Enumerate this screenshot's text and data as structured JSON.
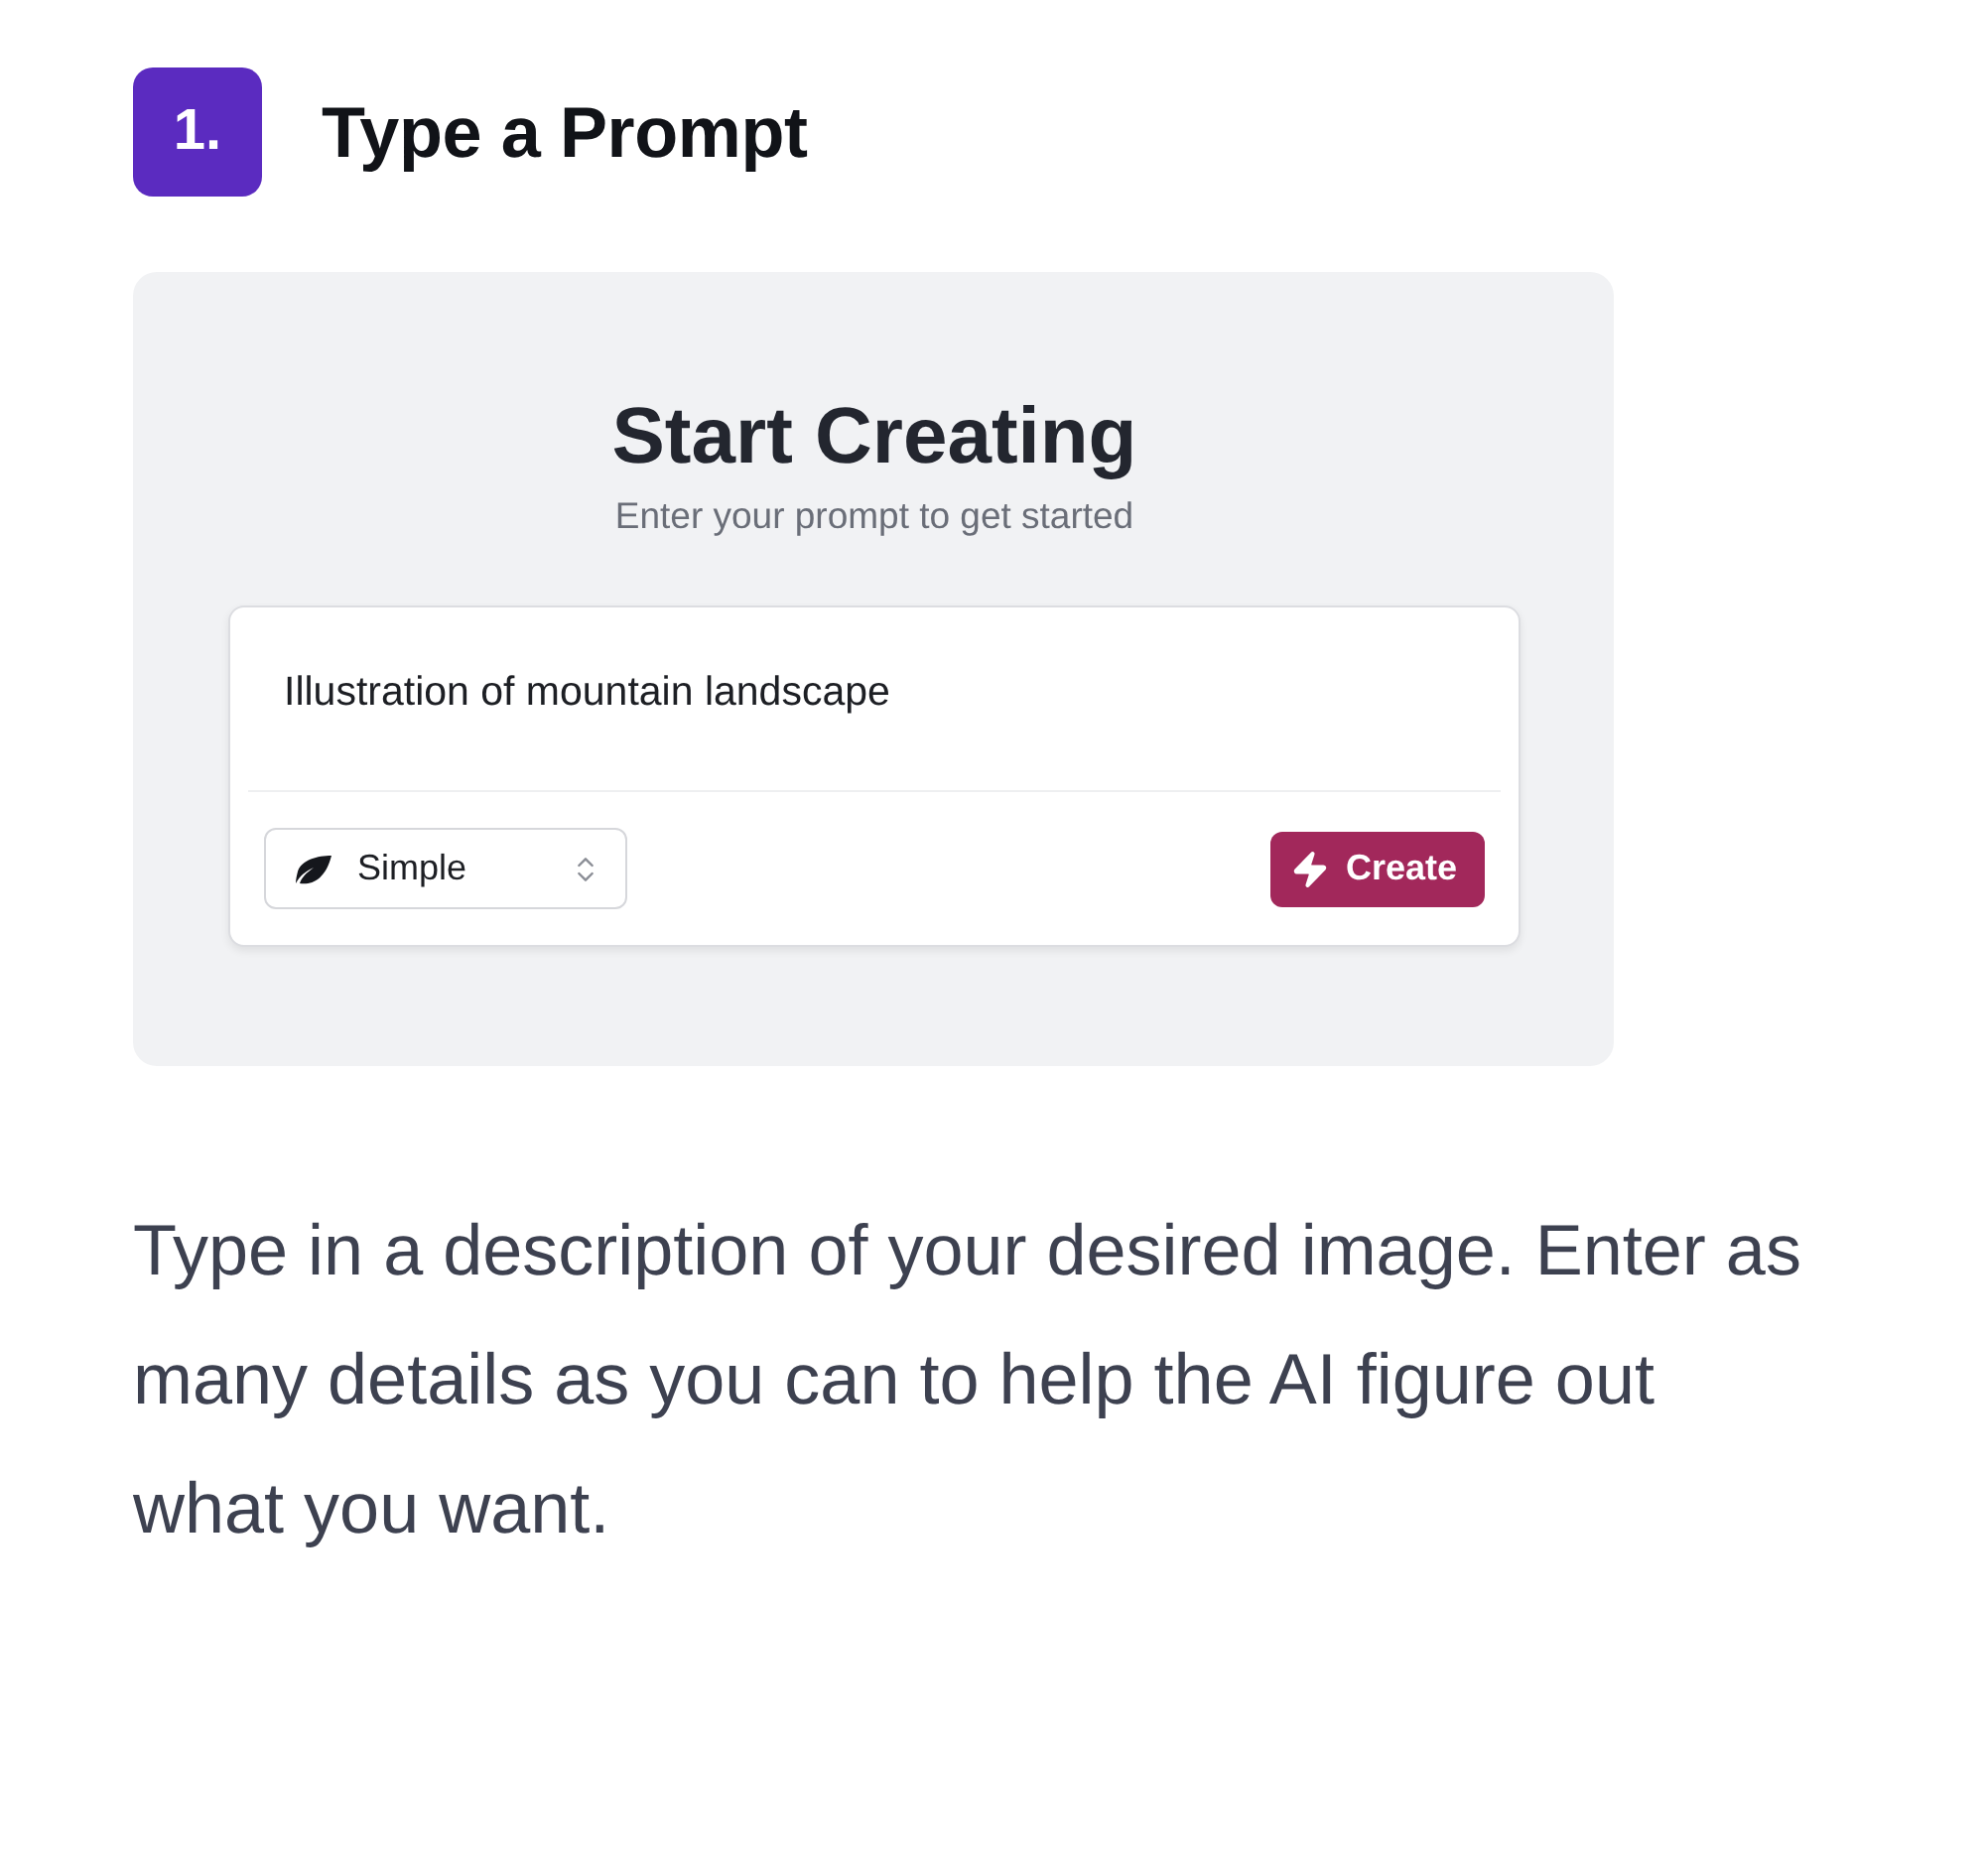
{
  "step": {
    "number": "1.",
    "title": "Type a Prompt"
  },
  "preview": {
    "title": "Start Creating",
    "subtitle": "Enter your prompt to get started",
    "prompt": {
      "value": "Illustration of mountain landscape"
    },
    "mode_select": {
      "value": "Simple"
    },
    "create_button": {
      "label": "Create"
    }
  },
  "description": "Type in a description of your desired image. Enter as many details as you can to help the AI figure out what you want."
}
